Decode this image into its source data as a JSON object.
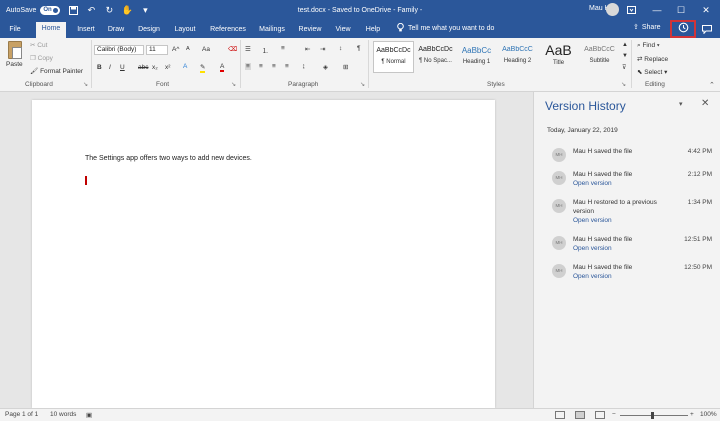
{
  "titlebar": {
    "autosave_label": "AutoSave",
    "autosave_state": "On",
    "doc_title": "test.docx  -  Saved to OneDrive - Family  -",
    "user_name": "Mau H"
  },
  "tabs": [
    "File",
    "Home",
    "Insert",
    "Draw",
    "Design",
    "Layout",
    "References",
    "Mailings",
    "Review",
    "View",
    "Help"
  ],
  "active_tab": "Home",
  "tell_me": "Tell me what you want to do",
  "share_label": "Share",
  "ribbon": {
    "clipboard": {
      "paste": "Paste",
      "cut": "Cut",
      "copy": "Copy",
      "format_painter": "Format Painter",
      "label": "Clipboard"
    },
    "font": {
      "family": "Calibri (Body)",
      "size": "11",
      "grow": "A^",
      "shrink": "A",
      "case": "Aa",
      "bold": "B",
      "italic": "I",
      "underline": "U",
      "strike": "abc",
      "subscript": "x₂",
      "superscript": "x²",
      "label": "Font"
    },
    "paragraph": {
      "label": "Paragraph",
      "pilcrow": "¶"
    },
    "styles": {
      "label": "Styles",
      "items": [
        {
          "sample": "AaBbCcDc",
          "name": "¶ Normal"
        },
        {
          "sample": "AaBbCcDc",
          "name": "¶ No Spac..."
        },
        {
          "sample": "AaBbCc",
          "name": "Heading 1"
        },
        {
          "sample": "AaBbCcC",
          "name": "Heading 2"
        },
        {
          "sample": "AaB",
          "name": "Title"
        },
        {
          "sample": "AaBbCcC",
          "name": "Subtitle"
        }
      ]
    },
    "editing": {
      "find": "Find",
      "replace": "Replace",
      "select": "Select",
      "label": "Editing"
    }
  },
  "document": {
    "text": "The Settings app offers two ways to add new devices."
  },
  "version_history": {
    "title": "Version History",
    "date_header": "Today, January 22, 2019",
    "entries": [
      {
        "desc": "Mau H saved the file",
        "time": "4:42 PM",
        "link": ""
      },
      {
        "desc": "Mau H saved the file",
        "time": "2:12 PM",
        "link": "Open version"
      },
      {
        "desc": "Mau H restored to a previous version",
        "time": "1:34 PM",
        "link": "Open version"
      },
      {
        "desc": "Mau H saved the file",
        "time": "12:51 PM",
        "link": "Open version"
      },
      {
        "desc": "Mau H saved the file",
        "time": "12:50 PM",
        "link": "Open version"
      }
    ],
    "avatar_text": "MH"
  },
  "statusbar": {
    "page": "Page 1 of 1",
    "words": "10 words",
    "zoom": "100%"
  },
  "colors": {
    "brand": "#2b579a",
    "highlight": "#d13438"
  }
}
